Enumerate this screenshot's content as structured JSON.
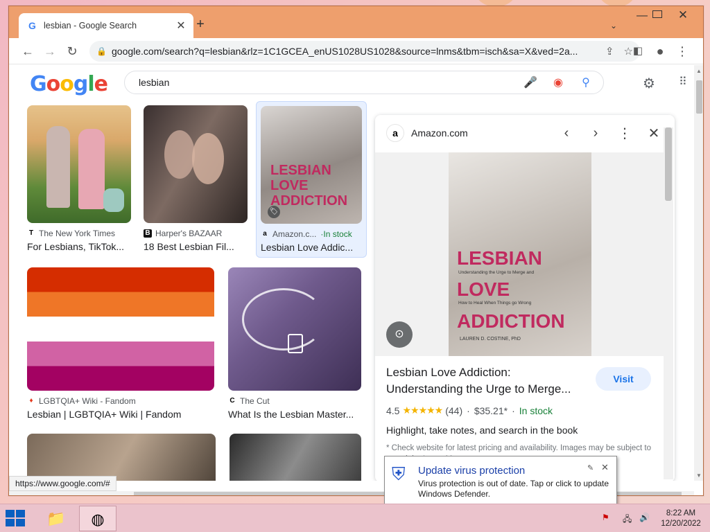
{
  "browser": {
    "tab_title": "lesbian - Google Search",
    "url": "google.com/search?q=lesbian&rlz=1C1GCEA_enUS1028US1028&source=lnms&tbm=isch&sa=X&ved=2a...",
    "status_url": "https://www.google.com/#"
  },
  "google": {
    "logo_letters": [
      "G",
      "o",
      "o",
      "g",
      "l",
      "e"
    ],
    "query": "lesbian"
  },
  "results": [
    {
      "source": "The New York Times",
      "title": "For Lesbians, TikTok..."
    },
    {
      "source": "Harper's BAZAAR",
      "title": "18 Best Lesbian Fil..."
    },
    {
      "source": "Amazon.c...",
      "badge": "In stock",
      "title": "Lesbian Love Addic..."
    },
    {
      "source": "LGBTQIA+ Wiki - Fandom",
      "title": "Lesbian | LGBTQIA+ Wiki | Fandom"
    },
    {
      "source": "The Cut",
      "title": "What Is the Lesbian Master..."
    }
  ],
  "panel": {
    "site": "Amazon.com",
    "book_title_line1": "LESBIAN",
    "book_title_line2": "LOVE",
    "book_title_line3": "ADDICTION",
    "book_subtitle": "Understanding the Urge to Merge and",
    "book_subtitle2": "How to Heal When Things go Wrong",
    "book_author": "LAUREN D. COSTINE, PhD",
    "title": "Lesbian Love Addiction: Understanding the Urge to Merge...",
    "visit_label": "Visit",
    "rating": "4.5",
    "stars": "★★★★★",
    "reviews": "(44)",
    "price": "$35.21*",
    "stock": "In stock",
    "description": "Highlight, take notes, and search in the book",
    "note": "* Check website for latest pricing and availability. Images may be subject to copyright. Learn More"
  },
  "notification": {
    "title": "Update virus protection",
    "body": "Virus protection is out of date. Tap or click to update Windows Defender."
  },
  "taskbar": {
    "time": "8:22 AM",
    "date": "12/20/2022"
  },
  "colors": {
    "titlebar": "#ee9f6d",
    "accent_blue": "#1a73e8",
    "in_stock_green": "#188038",
    "taskbar": "#ebc3cc"
  }
}
